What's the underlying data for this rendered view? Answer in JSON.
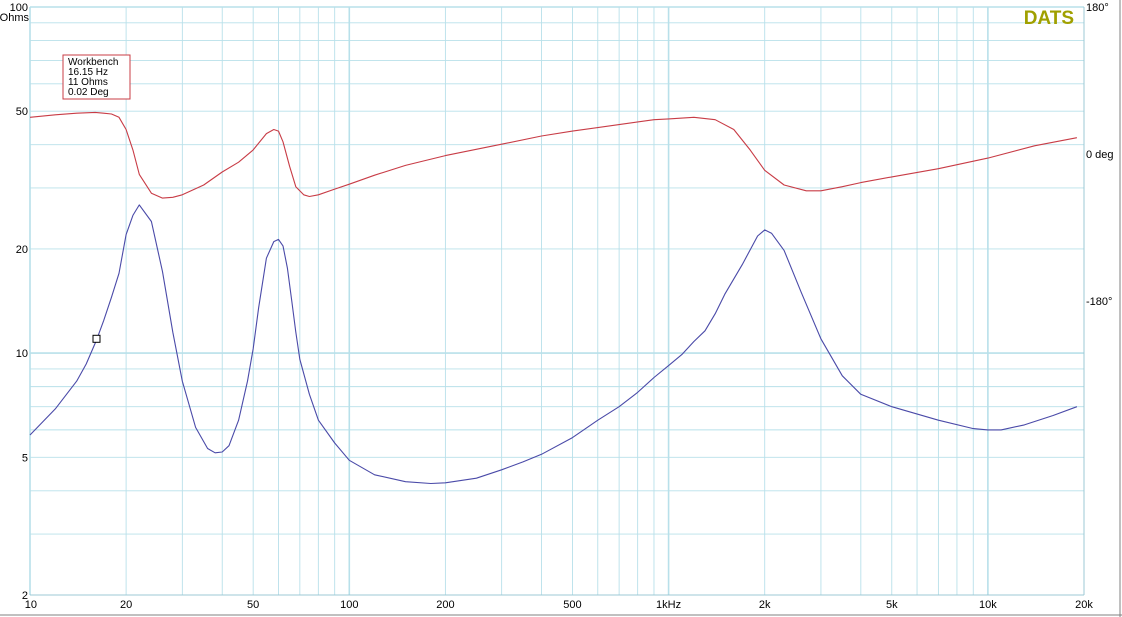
{
  "brand": "DATS",
  "colors": {
    "impedance": "#4a4aa8",
    "phase": "#c83c46",
    "grid": "#b8e0ea",
    "brand": "#a0a000",
    "axis_left_unit": "#4a4aa8",
    "axis_right_unit": "#c83c46",
    "tooltip_border": "#c83c46"
  },
  "tooltip": {
    "line1": "Workbench",
    "line2": "16.15 Hz",
    "line3": "11 Ohms",
    "line4": "0.02 Deg"
  },
  "chart_data": {
    "type": "line",
    "x_scale": "log",
    "xlim": [
      10,
      20000
    ],
    "y_left": {
      "scale": "log",
      "lim": [
        2,
        100
      ],
      "unit_label": "Ohms",
      "top_tick": "100",
      "ticks": [
        "50",
        "20",
        "10",
        "5",
        "2"
      ],
      "tick_values": [
        50,
        20,
        10,
        5,
        2
      ]
    },
    "y_right": {
      "lim": [
        -540,
        180
      ],
      "ticks": [
        "180°",
        "0 deg",
        "-180°"
      ],
      "tick_values": [
        180,
        0,
        -180
      ]
    },
    "x_tick_labels": [
      "10",
      "20",
      "50",
      "100",
      "200",
      "500",
      "1kHz",
      "2k",
      "5k",
      "10k",
      "20k"
    ],
    "x_tick_values": [
      10,
      20,
      50,
      100,
      200,
      500,
      1000,
      2000,
      5000,
      10000,
      20000
    ],
    "grid": true,
    "cursor": {
      "x": 16.15,
      "y": 11
    },
    "series": [
      {
        "key": "impedance",
        "axis": "left",
        "x": [
          10,
          12,
          14,
          15,
          16.15,
          17,
          18,
          19,
          20,
          21,
          22,
          24,
          26,
          28,
          30,
          33,
          36,
          38,
          40,
          42,
          45,
          48,
          50,
          52,
          55,
          58,
          60,
          62,
          64,
          66,
          68,
          70,
          75,
          80,
          90,
          100,
          120,
          150,
          180,
          200,
          250,
          300,
          350,
          400,
          500,
          600,
          700,
          800,
          900,
          1000,
          1100,
          1200,
          1300,
          1400,
          1500,
          1700,
          1900,
          2000,
          2100,
          2300,
          2600,
          3000,
          3500,
          4000,
          5000,
          7000,
          9000,
          10000,
          11000,
          13000,
          16000,
          19000
        ],
        "y": [
          5.8,
          6.9,
          8.3,
          9.3,
          10.9,
          12.4,
          14.5,
          17.0,
          22.0,
          25.0,
          26.8,
          24.0,
          17.2,
          11.5,
          8.3,
          6.1,
          5.3,
          5.15,
          5.18,
          5.4,
          6.4,
          8.3,
          10.3,
          13.5,
          18.8,
          21.0,
          21.3,
          20.4,
          17.6,
          14.2,
          11.5,
          9.6,
          7.6,
          6.4,
          5.5,
          4.9,
          4.45,
          4.25,
          4.2,
          4.22,
          4.35,
          4.6,
          4.85,
          5.1,
          5.7,
          6.4,
          7.0,
          7.7,
          8.5,
          9.2,
          9.9,
          10.8,
          11.6,
          13.0,
          14.8,
          18.0,
          21.8,
          22.7,
          22.2,
          19.8,
          15.0,
          11.0,
          8.6,
          7.6,
          7.0,
          6.4,
          6.05,
          6.0,
          6.0,
          6.2,
          6.6,
          7.0
        ]
      },
      {
        "key": "phase",
        "axis": "right",
        "x": [
          10,
          12,
          14,
          16,
          17,
          18,
          19,
          20,
          21,
          22,
          24,
          26,
          28,
          30,
          35,
          40,
          45,
          50,
          55,
          58,
          60,
          62,
          65,
          68,
          72,
          75,
          80,
          90,
          100,
          120,
          150,
          200,
          300,
          400,
          500,
          700,
          900,
          1000,
          1200,
          1400,
          1600,
          1800,
          2000,
          2300,
          2700,
          3000,
          3500,
          4000,
          5000,
          7000,
          10000,
          14000,
          19000
        ],
        "y": [
          45,
          48,
          50,
          51,
          50,
          49,
          45,
          30,
          5,
          -25,
          -48,
          -54,
          -53,
          -50,
          -38,
          -22,
          -10,
          5,
          25,
          30,
          28,
          15,
          -15,
          -40,
          -50,
          -52,
          -50,
          -43,
          -37,
          -26,
          -14,
          -2,
          12,
          22,
          28,
          36,
          42,
          43,
          45,
          42,
          30,
          5,
          -20,
          -38,
          -45,
          -45,
          -40,
          -35,
          -28,
          -18,
          -5,
          10,
          20
        ]
      }
    ]
  }
}
